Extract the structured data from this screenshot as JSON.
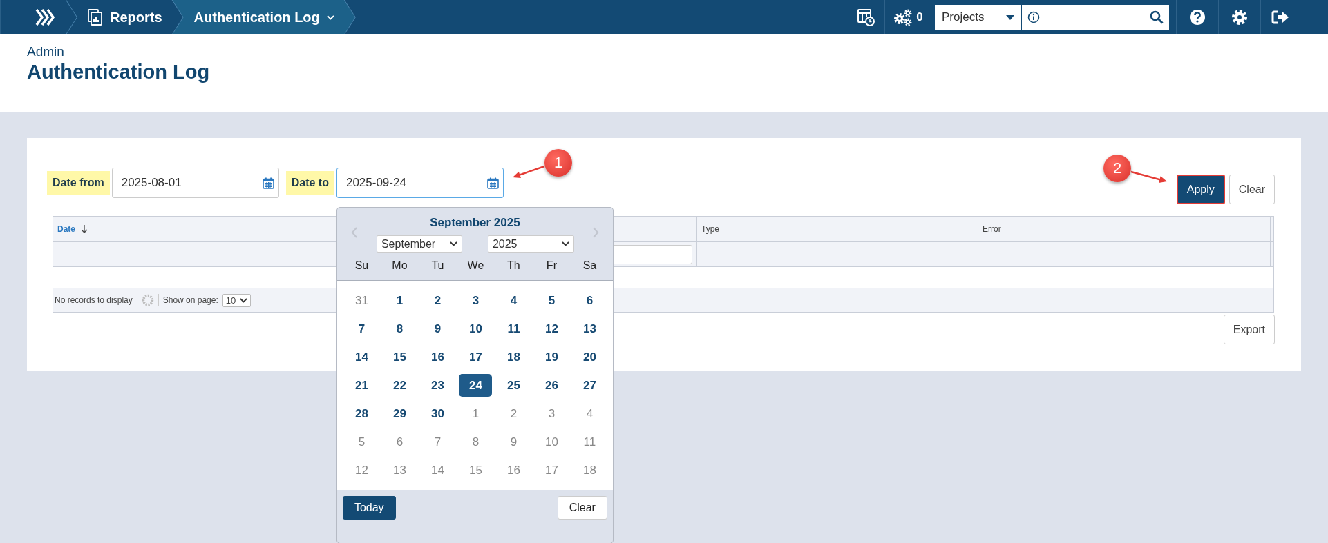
{
  "topbar": {
    "breadcrumbs": [
      {
        "label": "Reports",
        "selected": false,
        "dropdown": false
      },
      {
        "label": "Authentication Log",
        "selected": true,
        "dropdown": true
      }
    ],
    "jobs_count": "0",
    "project_select": {
      "value": "Projects"
    }
  },
  "header": {
    "section": "Admin",
    "title": "Authentication Log"
  },
  "filters": [
    {
      "label": "Date from",
      "value": "2025-08-01",
      "focused": false
    },
    {
      "label": "Date to",
      "value": "2025-09-24",
      "focused": true
    }
  ],
  "buttons": [
    {
      "label": "Apply",
      "kind": "primary",
      "highlighted": true
    },
    {
      "label": "Clear",
      "kind": "secondary",
      "highlighted": false
    }
  ],
  "table": {
    "columns": [
      {
        "label": "Date",
        "sorted": true,
        "filter": false
      },
      {
        "sorted": false,
        "filter": true
      },
      {
        "label": "Type",
        "sorted": false,
        "filter": false
      },
      {
        "label": "Error",
        "sorted": false,
        "filter": false
      }
    ],
    "pager": {
      "status": "No records to display",
      "page_size_label": "Show on page:",
      "page_size": "10"
    },
    "export_button": "Export"
  },
  "datepicker": {
    "title": "September 2025",
    "month": "September",
    "year": "2025",
    "weekdays": [
      "Su",
      "Mo",
      "Tu",
      "We",
      "Th",
      "Fr",
      "Sa"
    ],
    "days": [
      {
        "label": "31",
        "outside": true,
        "selected": false
      },
      {
        "label": "1",
        "outside": false,
        "selected": false
      },
      {
        "label": "2",
        "outside": false,
        "selected": false
      },
      {
        "label": "3",
        "outside": false,
        "selected": false
      },
      {
        "label": "4",
        "outside": false,
        "selected": false
      },
      {
        "label": "5",
        "outside": false,
        "selected": false
      },
      {
        "label": "6",
        "outside": false,
        "selected": false
      },
      {
        "label": "7",
        "outside": false,
        "selected": false
      },
      {
        "label": "8",
        "outside": false,
        "selected": false
      },
      {
        "label": "9",
        "outside": false,
        "selected": false
      },
      {
        "label": "10",
        "outside": false,
        "selected": false
      },
      {
        "label": "11",
        "outside": false,
        "selected": false
      },
      {
        "label": "12",
        "outside": false,
        "selected": false
      },
      {
        "label": "13",
        "outside": false,
        "selected": false
      },
      {
        "label": "14",
        "outside": false,
        "selected": false
      },
      {
        "label": "15",
        "outside": false,
        "selected": false
      },
      {
        "label": "16",
        "outside": false,
        "selected": false
      },
      {
        "label": "17",
        "outside": false,
        "selected": false
      },
      {
        "label": "18",
        "outside": false,
        "selected": false
      },
      {
        "label": "19",
        "outside": false,
        "selected": false
      },
      {
        "label": "20",
        "outside": false,
        "selected": false
      },
      {
        "label": "21",
        "outside": false,
        "selected": false
      },
      {
        "label": "22",
        "outside": false,
        "selected": false
      },
      {
        "label": "23",
        "outside": false,
        "selected": false
      },
      {
        "label": "24",
        "outside": false,
        "selected": true
      },
      {
        "label": "25",
        "outside": false,
        "selected": false
      },
      {
        "label": "26",
        "outside": false,
        "selected": false
      },
      {
        "label": "27",
        "outside": false,
        "selected": false
      },
      {
        "label": "28",
        "outside": false,
        "selected": false
      },
      {
        "label": "29",
        "outside": false,
        "selected": false
      },
      {
        "label": "30",
        "outside": false,
        "selected": false
      },
      {
        "label": "1",
        "outside": true,
        "selected": false
      },
      {
        "label": "2",
        "outside": true,
        "selected": false
      },
      {
        "label": "3",
        "outside": true,
        "selected": false
      },
      {
        "label": "4",
        "outside": true,
        "selected": false
      },
      {
        "label": "5",
        "outside": true,
        "selected": false
      },
      {
        "label": "6",
        "outside": true,
        "selected": false
      },
      {
        "label": "7",
        "outside": true,
        "selected": false
      },
      {
        "label": "8",
        "outside": true,
        "selected": false
      },
      {
        "label": "9",
        "outside": true,
        "selected": false
      },
      {
        "label": "10",
        "outside": true,
        "selected": false
      },
      {
        "label": "11",
        "outside": true,
        "selected": false
      },
      {
        "label": "12",
        "outside": true,
        "selected": false
      },
      {
        "label": "13",
        "outside": true,
        "selected": false
      },
      {
        "label": "14",
        "outside": true,
        "selected": false
      },
      {
        "label": "15",
        "outside": true,
        "selected": false
      },
      {
        "label": "16",
        "outside": true,
        "selected": false
      },
      {
        "label": "17",
        "outside": true,
        "selected": false
      },
      {
        "label": "18",
        "outside": true,
        "selected": false
      }
    ],
    "today_button": "Today",
    "clear_button": "Clear"
  },
  "annotations": [
    {
      "label": "1"
    },
    {
      "label": "2"
    }
  ]
}
